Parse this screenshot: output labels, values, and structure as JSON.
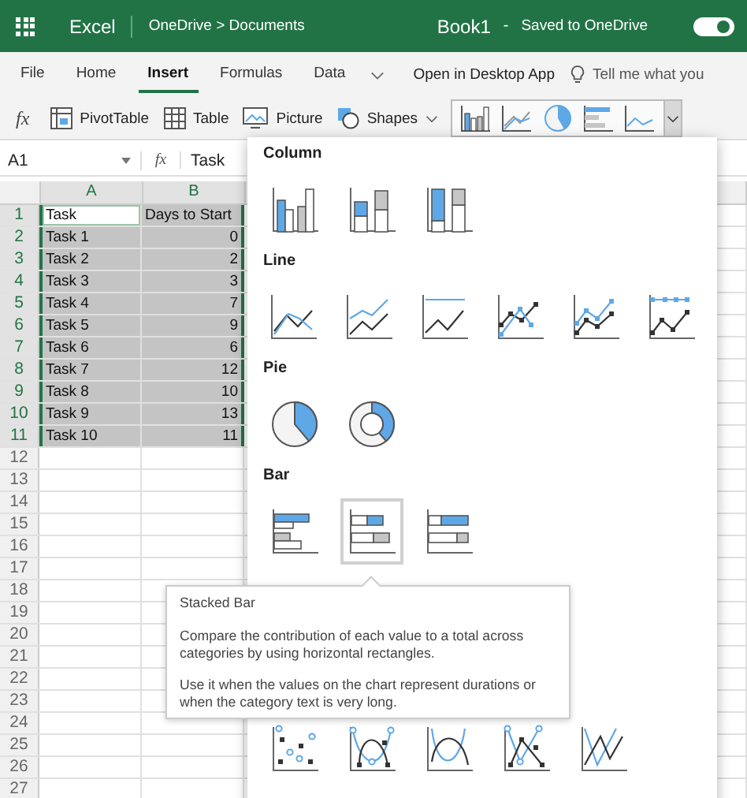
{
  "title_bar": {
    "app": "Excel",
    "breadcrumb": "OneDrive > Documents",
    "document": "Book1",
    "separator": "-",
    "status": "Saved to OneDrive",
    "toggle_on": true
  },
  "ribbon_tabs": [
    {
      "label": "File",
      "selected": false
    },
    {
      "label": "Home",
      "selected": false
    },
    {
      "label": "Insert",
      "selected": true
    },
    {
      "label": "Formulas",
      "selected": false
    },
    {
      "label": "Data",
      "selected": false
    }
  ],
  "open_desktop": "Open in Desktop App",
  "tell_me": {
    "placeholder": "Tell me what you"
  },
  "toolbar_function_label": "fx",
  "toolbar": [
    {
      "kind": "pivot",
      "label": "PivotTable",
      "dropdown": false
    },
    {
      "kind": "table",
      "label": "Table",
      "dropdown": false
    },
    {
      "kind": "picture",
      "label": "Picture",
      "dropdown": false
    },
    {
      "kind": "shapes",
      "label": "Shapes",
      "dropdown": true
    }
  ],
  "chart_buttons": [
    {
      "kind": "column"
    },
    {
      "kind": "line"
    },
    {
      "kind": "pie"
    },
    {
      "kind": "bar"
    },
    {
      "kind": "area"
    }
  ],
  "formula_bar": {
    "name_box": "A1",
    "function_label": "fx",
    "value": "Task"
  },
  "sheet": {
    "columns": [
      "A",
      "B"
    ],
    "rows": [
      {
        "number": "1",
        "selected": true,
        "cells": [
          {
            "text": "Task",
            "active": true,
            "numeric": false
          },
          {
            "text": "Days to Start",
            "active": false,
            "numeric": false
          }
        ]
      },
      {
        "number": "2",
        "selected": true,
        "cells": [
          {
            "text": "Task 1",
            "active": false,
            "numeric": false
          },
          {
            "text": "0",
            "active": false,
            "numeric": true
          }
        ]
      },
      {
        "number": "3",
        "selected": true,
        "cells": [
          {
            "text": "Task 2",
            "active": false,
            "numeric": false
          },
          {
            "text": "2",
            "active": false,
            "numeric": true
          }
        ]
      },
      {
        "number": "4",
        "selected": true,
        "cells": [
          {
            "text": "Task 3",
            "active": false,
            "numeric": false
          },
          {
            "text": "3",
            "active": false,
            "numeric": true
          }
        ]
      },
      {
        "number": "5",
        "selected": true,
        "cells": [
          {
            "text": "Task 4",
            "active": false,
            "numeric": false
          },
          {
            "text": "7",
            "active": false,
            "numeric": true
          }
        ]
      },
      {
        "number": "6",
        "selected": true,
        "cells": [
          {
            "text": "Task 5",
            "active": false,
            "numeric": false
          },
          {
            "text": "9",
            "active": false,
            "numeric": true
          }
        ]
      },
      {
        "number": "7",
        "selected": true,
        "cells": [
          {
            "text": "Task 6",
            "active": false,
            "numeric": false
          },
          {
            "text": "6",
            "active": false,
            "numeric": true
          }
        ]
      },
      {
        "number": "8",
        "selected": true,
        "cells": [
          {
            "text": "Task 7",
            "active": false,
            "numeric": false
          },
          {
            "text": "12",
            "active": false,
            "numeric": true
          }
        ]
      },
      {
        "number": "9",
        "selected": true,
        "cells": [
          {
            "text": "Task 8",
            "active": false,
            "numeric": false
          },
          {
            "text": "10",
            "active": false,
            "numeric": true
          }
        ]
      },
      {
        "number": "10",
        "selected": true,
        "cells": [
          {
            "text": "Task 9",
            "active": false,
            "numeric": false
          },
          {
            "text": "13",
            "active": false,
            "numeric": true
          }
        ]
      },
      {
        "number": "11",
        "selected": true,
        "cells": [
          {
            "text": "Task 10",
            "active": false,
            "numeric": false
          },
          {
            "text": "11",
            "active": false,
            "numeric": true
          }
        ]
      },
      {
        "number": "12",
        "selected": false
      },
      {
        "number": "13",
        "selected": false
      },
      {
        "number": "14",
        "selected": false
      },
      {
        "number": "15",
        "selected": false
      },
      {
        "number": "16",
        "selected": false
      },
      {
        "number": "17",
        "selected": false
      },
      {
        "number": "18",
        "selected": false
      },
      {
        "number": "19",
        "selected": false
      },
      {
        "number": "20",
        "selected": false
      },
      {
        "number": "21",
        "selected": false
      },
      {
        "number": "22",
        "selected": false
      },
      {
        "number": "23",
        "selected": false
      },
      {
        "number": "24",
        "selected": false
      },
      {
        "number": "25",
        "selected": false
      },
      {
        "number": "26",
        "selected": false
      },
      {
        "number": "27",
        "selected": false
      }
    ]
  },
  "chart_menu": {
    "sections": [
      {
        "heading": "Column",
        "items": [
          {
            "kind": "clustered-column",
            "selected": false
          },
          {
            "kind": "stacked-column",
            "selected": false
          },
          {
            "kind": "stacked100-column",
            "selected": false
          }
        ]
      },
      {
        "heading": "Line",
        "items": [
          {
            "kind": "line",
            "selected": false
          },
          {
            "kind": "stacked-line",
            "selected": false
          },
          {
            "kind": "stacked100-line",
            "selected": false
          },
          {
            "kind": "line-markers",
            "selected": false
          },
          {
            "kind": "stacked-line-markers",
            "selected": false
          },
          {
            "kind": "stacked100-line-markers",
            "selected": false
          }
        ]
      },
      {
        "heading": "Pie",
        "items": [
          {
            "kind": "pie",
            "selected": false
          },
          {
            "kind": "donut",
            "selected": false
          }
        ]
      },
      {
        "heading": "Bar",
        "items": [
          {
            "kind": "clustered-bar",
            "selected": false
          },
          {
            "kind": "stacked-bar",
            "selected": true
          },
          {
            "kind": "stacked100-bar",
            "selected": false
          }
        ]
      },
      {
        "items": [
          {
            "kind": "scatter",
            "selected": false
          },
          {
            "kind": "smooth-markers",
            "selected": false
          },
          {
            "kind": "smooth",
            "selected": false
          },
          {
            "kind": "straight-markers",
            "selected": false
          },
          {
            "kind": "straight",
            "selected": false
          }
        ]
      }
    ],
    "tooltip": {
      "title": "Stacked Bar",
      "paragraphs": [
        "Compare the contribution of each value to a total across categories by using horizontal rectangles.",
        "Use it when the values on the chart represent durations or when the category text is very long."
      ]
    }
  }
}
